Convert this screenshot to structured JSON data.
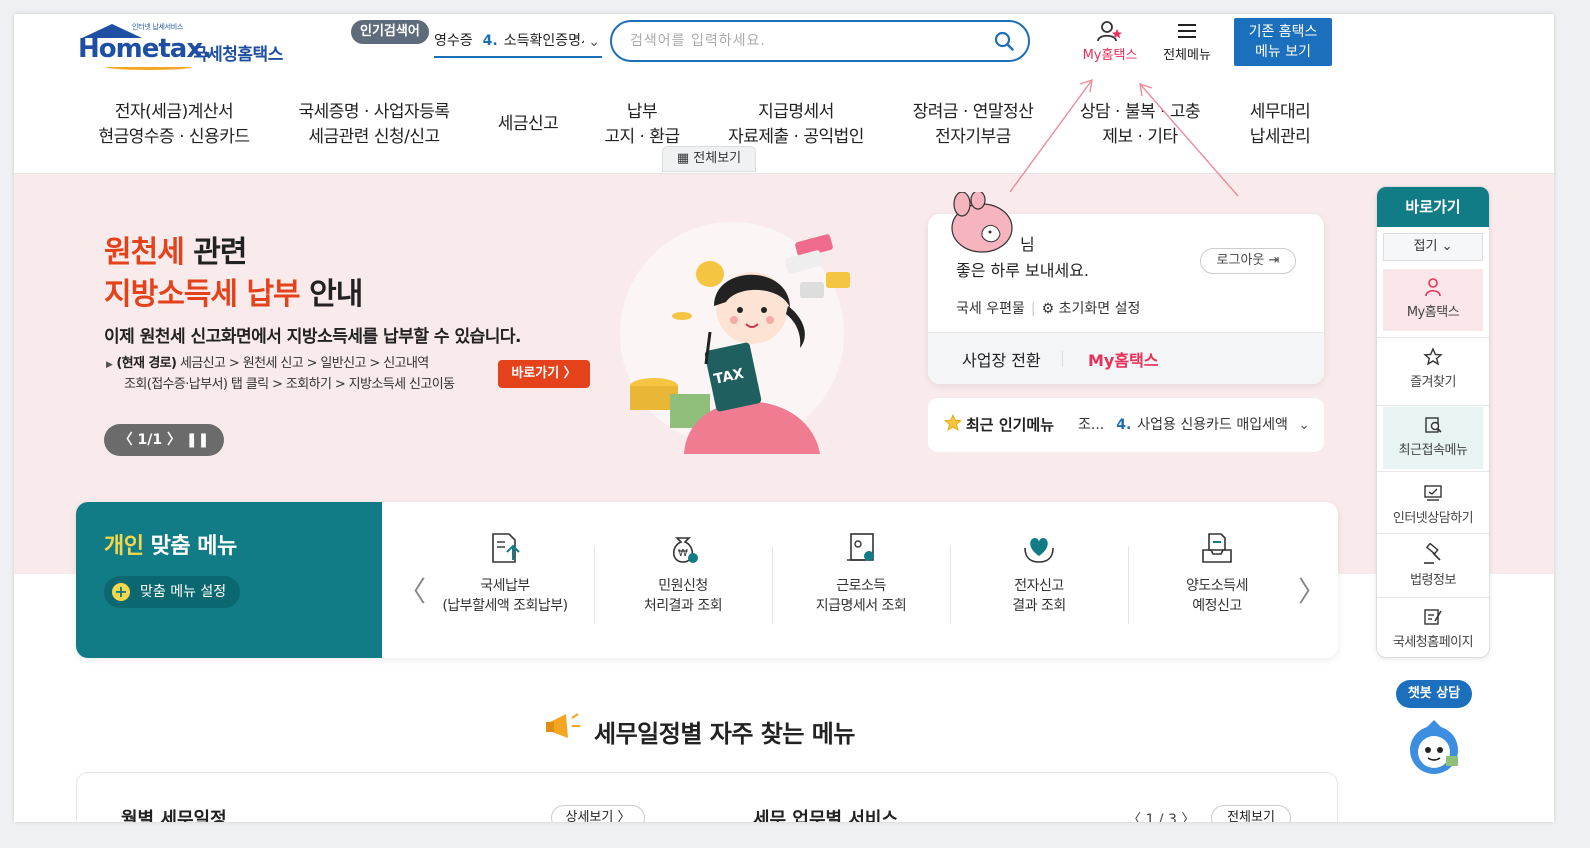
{
  "header": {
    "logo_tagline": "인터넷 납세서비스",
    "logo_text": "Hometax.",
    "logo_korean": "국세청홈택스",
    "popular_badge": "인기검색어",
    "popular_roll_prefix": "영수증",
    "popular_roll_num": "4.",
    "popular_roll_text": "소득확인증명서",
    "search_placeholder": "검색어를 입력하세요.",
    "my_hometax": "My홈택스",
    "all_menu": "전체메뉴",
    "old_menu_line1": "기존 홈택스",
    "old_menu_line2": "메뉴 보기"
  },
  "gnb": [
    {
      "line1": "전자(세금)계산서",
      "line2": "현금영수증 · 신용카드"
    },
    {
      "line1": "국세증명 · 사업자등록",
      "line2": "세금관련 신청/신고"
    },
    {
      "line1": "세금신고",
      "line2": ""
    },
    {
      "line1": "납부",
      "line2": "고지 · 환급"
    },
    {
      "line1": "지급명세서",
      "line2": "자료제출 · 공익법인"
    },
    {
      "line1": "장려금 · 연말정산",
      "line2": "전자기부금"
    },
    {
      "line1": "상담 · 불복 · 고충",
      "line2": "제보 · 기타"
    },
    {
      "line1": "세무대리",
      "line2": "납세관리"
    }
  ],
  "hero": {
    "title_red1": "원천세",
    "title_rest1": " 관련",
    "title_red2": "지방소득세 납부",
    "title_rest2": " 안내",
    "subtitle": "이제 원천세 신고화면에서 지방소득세를 납부할 수 있습니다.",
    "path_label": "(현재 경로)",
    "path_line1": "세금신고 > 원천세 신고 > 일반신고 > 신고내역",
    "path_line2": "조회(접수증·납부서) 탭 클릭 > 조회하기 > 지방소득세 신고이동",
    "go_button": "바로가기  〉",
    "pager": "〈  1/1  〉   ❚❚",
    "tax_label": "TAX"
  },
  "login": {
    "greeting_suffix": "님",
    "greeting_line2": "좋은 하루 보내세요.",
    "logout": "로그아웃",
    "mailbox": "국세 우편물",
    "initial_setting": "초기화면 설정",
    "switch_biz": "사업장 전환",
    "my_hometax": "My홈택스"
  },
  "popular_menu": {
    "label": "최근 인기메뉴",
    "prefix": "조...",
    "num": "4.",
    "text": "사업용 신용카드 매입세액"
  },
  "custom_menu": {
    "title_yellow": "개인",
    "title_rest": " 맞춤 메뉴",
    "setting": "맞춤 메뉴 설정",
    "items": [
      {
        "line1": "국세납부",
        "line2": "(납부할세액 조회납부)"
      },
      {
        "line1": "민원신청",
        "line2": "처리결과 조회"
      },
      {
        "line1": "근로소득",
        "line2": "지급명세서 조회"
      },
      {
        "line1": "전자신고",
        "line2": "결과 조회"
      },
      {
        "line1": "양도소득세",
        "line2": "예정신고"
      }
    ],
    "view_all": "전체보기"
  },
  "schedule": {
    "title": "세무일정별 자주 찾는 메뉴",
    "monthly": "월별 세무일정",
    "more": "상세보기  〉",
    "service": "세무 업무별 서비스",
    "page": "〈  1 / 3  〉",
    "view_all": "전체보기"
  },
  "quick": {
    "title": "바로가기",
    "fold": "접기 ⌄",
    "items": [
      {
        "label": "My홈택스"
      },
      {
        "label": "즐겨찾기"
      },
      {
        "label": "최근접속메뉴"
      },
      {
        "label": "인터넷상담하기"
      },
      {
        "label": "법령정보"
      },
      {
        "label": "국세청홈페이지"
      }
    ]
  },
  "chatbot": "챗봇 상담",
  "colors": {
    "primary_blue": "#1c6fbd",
    "teal": "#117c86",
    "accent_red": "#e4421a",
    "pink": "#e6325a",
    "hero_bg": "#f9ebeb"
  }
}
